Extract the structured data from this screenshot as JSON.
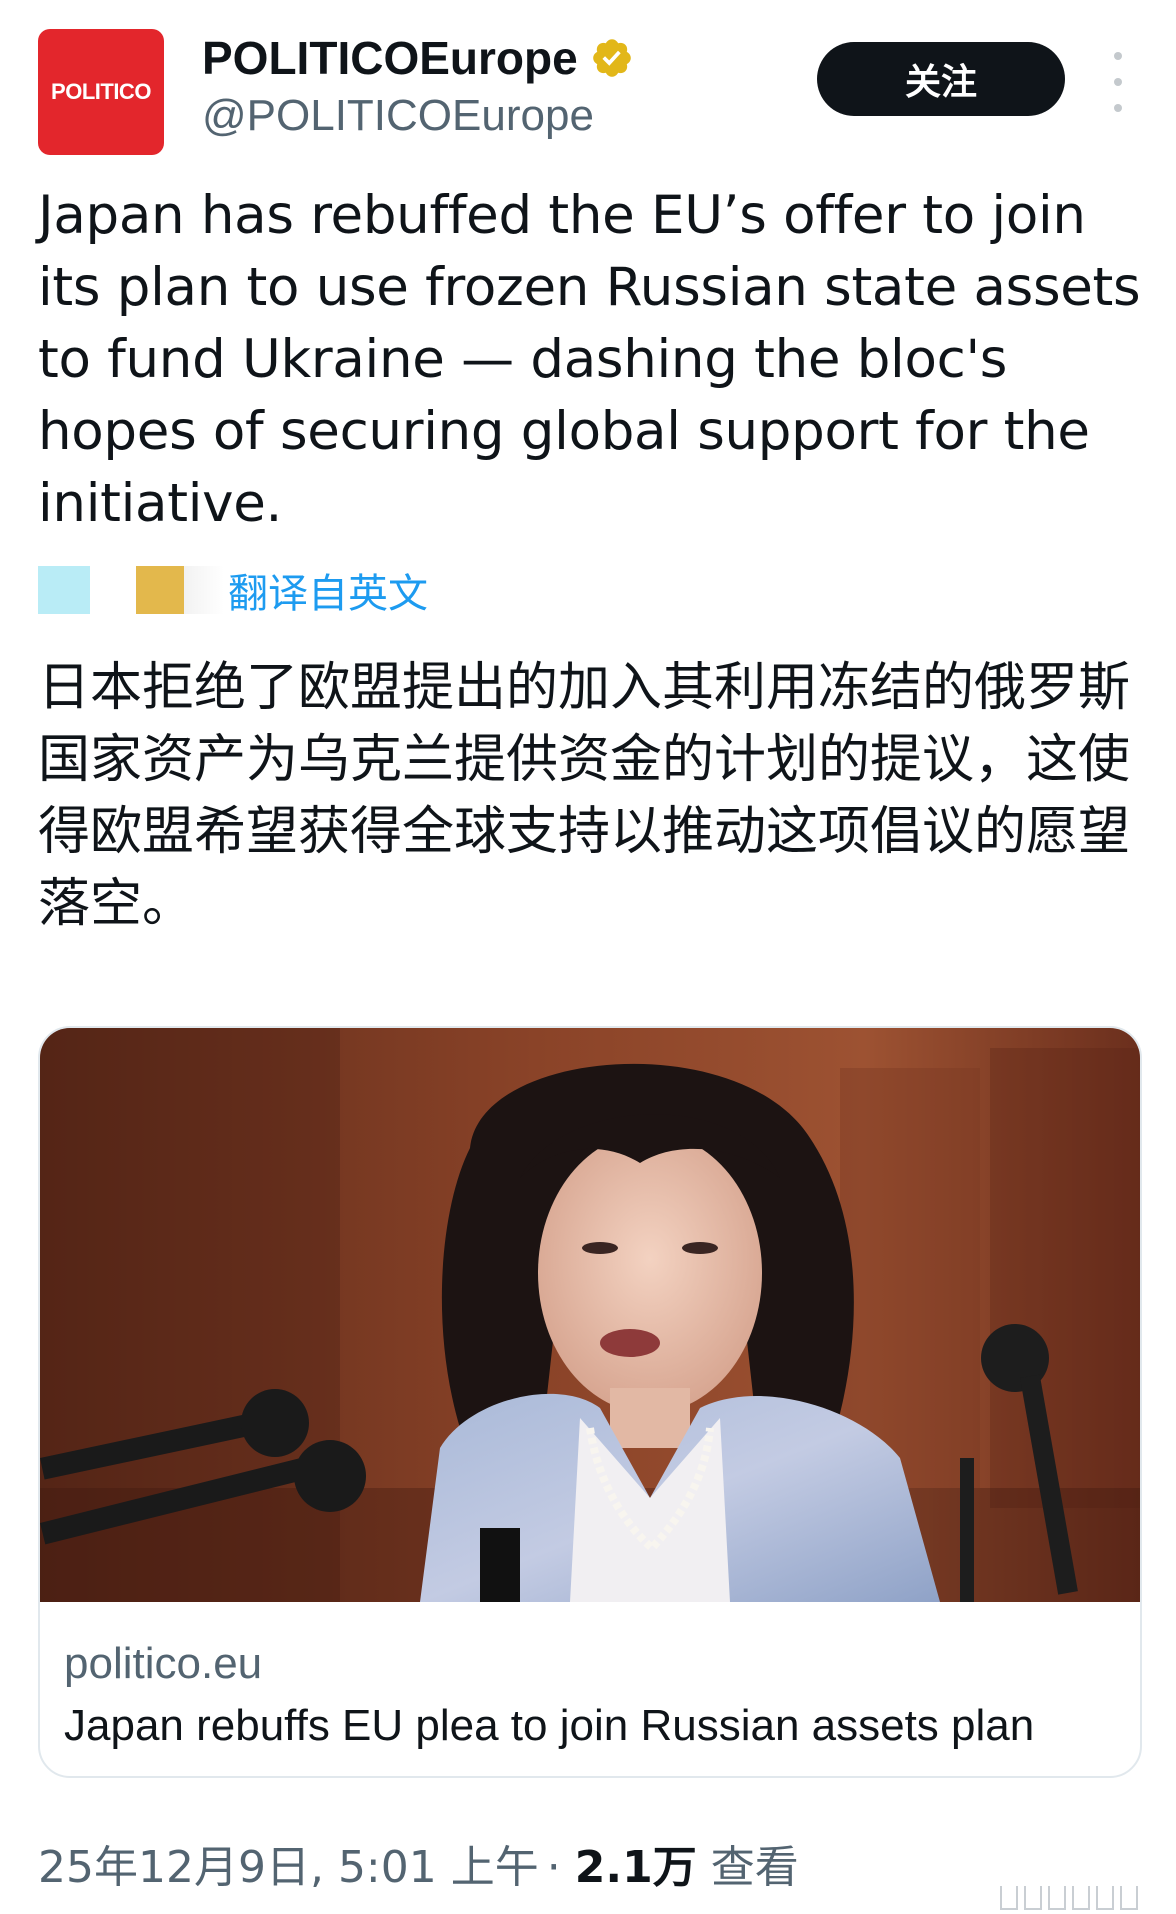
{
  "account": {
    "avatar_text": "POLITICO",
    "display_name": "POLITICOEurope",
    "handle": "@POLITICOEurope",
    "verified_icon": "verified-badge-gold",
    "avatar_color": "#e3262c"
  },
  "actions": {
    "follow_label": "关注",
    "more_icon": "more-vertical-icon"
  },
  "tweet": {
    "text": "Japan has rebuffed the EU’s offer to join its plan to use frozen Russian state assets to fund Ukraine — dashing the bloc's hopes of securing global support for the initiative.",
    "translate_label": "翻译自英文",
    "translated_text": "日本拒绝了欧盟提出的加入其利用冻结的俄罗斯国家资产为乌克兰提供资金的计划的提议，这使得欧盟希望获得全球支持以推动这项倡议的愿望落空。"
  },
  "card": {
    "domain": "politico.eu",
    "title": "Japan rebuffs EU plea to join Russian assets plan"
  },
  "footer": {
    "timestamp": "25年12月9日, 5:01 上午",
    "separator": "·",
    "views_count": "2.1万",
    "views_label": "查看"
  },
  "colors": {
    "text_primary": "#0f1419",
    "text_secondary": "#536471",
    "link": "#1d9bf0",
    "button_bg": "#0f1419"
  }
}
